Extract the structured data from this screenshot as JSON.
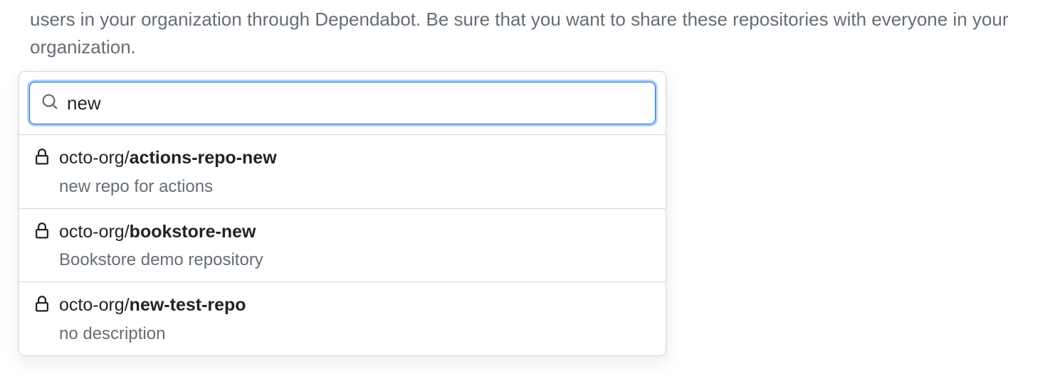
{
  "description": "users in your organization through Dependabot. Be sure that you want to share these repositories with everyone in your organization.",
  "search": {
    "value": "new"
  },
  "results": [
    {
      "owner": "octo-org/",
      "repo": "actions-repo-new",
      "description": "new repo for actions"
    },
    {
      "owner": "octo-org/",
      "repo": "bookstore-new",
      "description": "Bookstore demo repository"
    },
    {
      "owner": "octo-org/",
      "repo": "new-test-repo",
      "description": "no description"
    }
  ]
}
